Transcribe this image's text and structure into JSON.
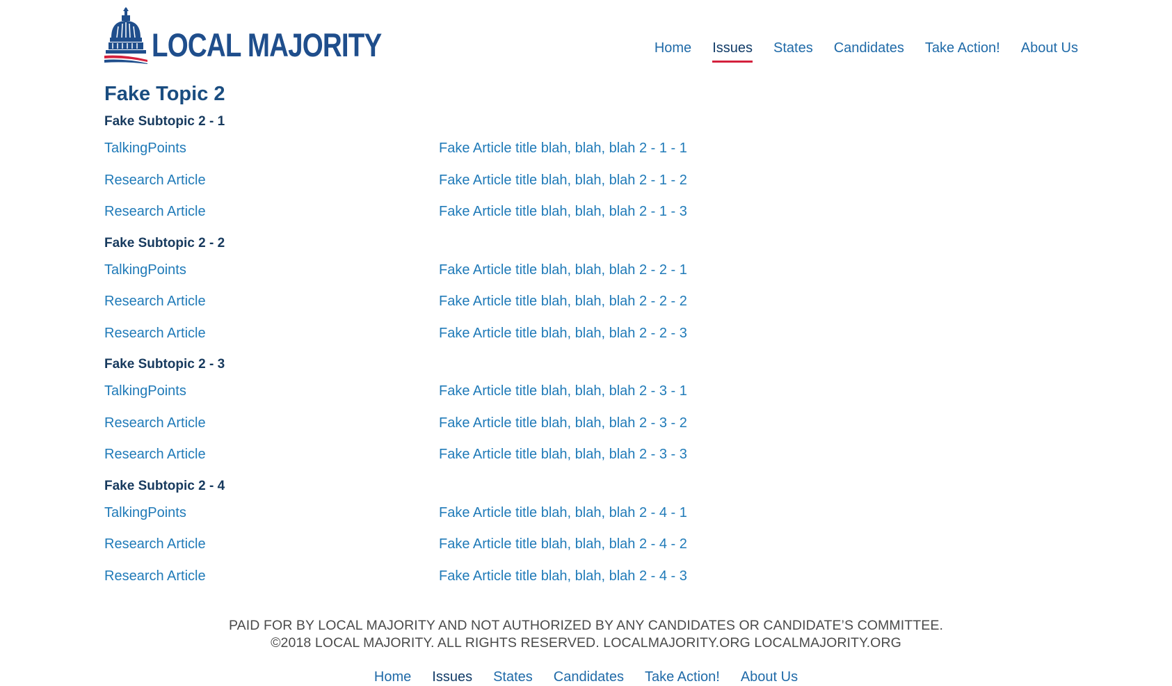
{
  "brand": {
    "logo_text": "LOCAL MAJORITY",
    "trademark": "™",
    "colors": {
      "primary": "#1f4e8c",
      "accent": "#d4213d",
      "link": "#1f7ab8"
    }
  },
  "nav": {
    "items": [
      {
        "label": "Home"
      },
      {
        "label": "Issues",
        "active": true
      },
      {
        "label": "States"
      },
      {
        "label": "Candidates"
      },
      {
        "label": "Take Action!"
      },
      {
        "label": "About Us"
      }
    ]
  },
  "main": {
    "title": "Fake Topic 2",
    "subtopics": [
      {
        "title": "Fake Subtopic 2 - 1",
        "rows": [
          {
            "type": "TalkingPoints",
            "article": "Fake Article title blah, blah, blah 2 - 1 - 1"
          },
          {
            "type": "Research Article",
            "article": "Fake Article title blah, blah, blah 2 - 1 - 2"
          },
          {
            "type": "Research Article",
            "article": "Fake Article title blah, blah, blah 2 - 1 - 3"
          }
        ]
      },
      {
        "title": "Fake Subtopic 2 - 2",
        "rows": [
          {
            "type": "TalkingPoints",
            "article": "Fake Article title blah, blah, blah 2 - 2 - 1"
          },
          {
            "type": "Research Article",
            "article": "Fake Article title blah, blah, blah 2 - 2 - 2"
          },
          {
            "type": "Research Article",
            "article": "Fake Article title blah, blah, blah 2 - 2 - 3"
          }
        ]
      },
      {
        "title": "Fake Subtopic 2 - 3",
        "rows": [
          {
            "type": "TalkingPoints",
            "article": "Fake Article title blah, blah, blah 2 - 3 - 1"
          },
          {
            "type": "Research Article",
            "article": "Fake Article title blah, blah, blah 2 - 3 - 2"
          },
          {
            "type": "Research Article",
            "article": "Fake Article title blah, blah, blah 2 - 3 - 3"
          }
        ]
      },
      {
        "title": "Fake Subtopic 2 - 4",
        "rows": [
          {
            "type": "TalkingPoints",
            "article": "Fake Article title blah, blah, blah 2 - 4 - 1"
          },
          {
            "type": "Research Article",
            "article": "Fake Article title blah, blah, blah 2 - 4 - 2"
          },
          {
            "type": "Research Article",
            "article": "Fake Article title blah, blah, blah 2 - 4 - 3"
          }
        ]
      }
    ]
  },
  "footer": {
    "disclaimer": "PAID FOR BY LOCAL MAJORITY AND NOT AUTHORIZED BY ANY CANDIDATES OR CANDIDATE’S COMMITTEE.",
    "copyright": "©2018 LOCAL MAJORITY. ALL RIGHTS RESERVED. LOCALMAJORITY.ORG LOCALMAJORITY.ORG"
  }
}
